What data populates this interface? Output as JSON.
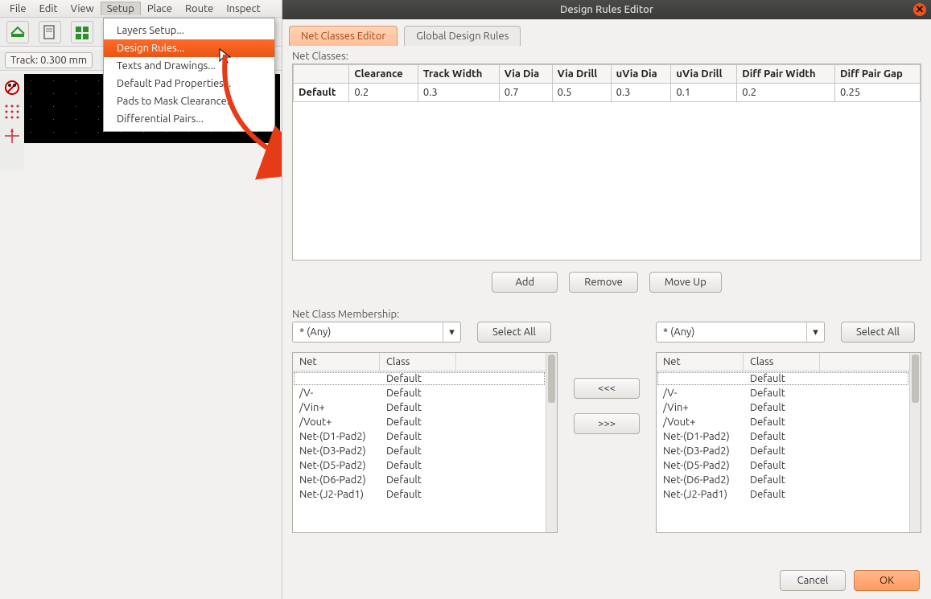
{
  "menubar": {
    "items": [
      "File",
      "Edit",
      "View",
      "Setup",
      "Place",
      "Route",
      "Inspect"
    ],
    "open_index": 3
  },
  "toolbar": {
    "track_label": "Track: 0.300 mm"
  },
  "setup_menu": {
    "items": [
      "Layers Setup...",
      "Design Rules...",
      "Texts and Drawings...",
      "Default Pad Properties...",
      "Pads to Mask Clearance...",
      "Differential Pairs..."
    ],
    "highlight_index": 1
  },
  "dialog": {
    "title": "Design Rules Editor",
    "tabs": [
      "Net Classes Editor",
      "Global Design Rules"
    ],
    "active_tab": 0,
    "net_classes_label": "Net Classes:",
    "rules_headers": [
      "",
      "Clearance",
      "Track Width",
      "Via Dia",
      "Via Drill",
      "uVia Dia",
      "uVia Drill",
      "Diff Pair Width",
      "Diff Pair Gap"
    ],
    "rules_rows": [
      {
        "name": "Default",
        "values": [
          "0.2",
          "0.3",
          "0.7",
          "0.5",
          "0.3",
          "0.1",
          "0.2",
          "0.25"
        ]
      }
    ],
    "buttons": {
      "add": "Add",
      "remove": "Remove",
      "moveup": "Move Up"
    },
    "membership_label": "Net Class Membership:",
    "filter_value": "* (Any)",
    "select_all": "Select All",
    "net_header": "Net",
    "class_header": "Class",
    "shuttle": {
      "left": "<<<",
      "right": ">>>"
    },
    "nets_left": [
      {
        "net": "",
        "class": "Default"
      },
      {
        "net": "/V-",
        "class": "Default"
      },
      {
        "net": "/Vin+",
        "class": "Default"
      },
      {
        "net": "/Vout+",
        "class": "Default"
      },
      {
        "net": "Net-(D1-Pad2)",
        "class": "Default"
      },
      {
        "net": "Net-(D3-Pad2)",
        "class": "Default"
      },
      {
        "net": "Net-(D5-Pad2)",
        "class": "Default"
      },
      {
        "net": "Net-(D6-Pad2)",
        "class": "Default"
      },
      {
        "net": "Net-(J2-Pad1)",
        "class": "Default"
      }
    ],
    "nets_right": [
      {
        "net": "",
        "class": "Default"
      },
      {
        "net": "/V-",
        "class": "Default"
      },
      {
        "net": "/Vin+",
        "class": "Default"
      },
      {
        "net": "/Vout+",
        "class": "Default"
      },
      {
        "net": "Net-(D1-Pad2)",
        "class": "Default"
      },
      {
        "net": "Net-(D3-Pad2)",
        "class": "Default"
      },
      {
        "net": "Net-(D5-Pad2)",
        "class": "Default"
      },
      {
        "net": "Net-(D6-Pad2)",
        "class": "Default"
      },
      {
        "net": "Net-(J2-Pad1)",
        "class": "Default"
      }
    ],
    "footer": {
      "cancel": "Cancel",
      "ok": "OK"
    }
  }
}
